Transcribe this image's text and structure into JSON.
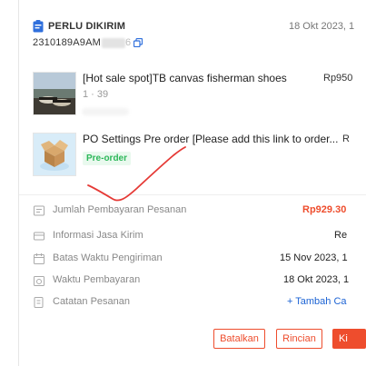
{
  "header": {
    "status": "PERLU DIKIRIM",
    "date": "18 Okt 2023, 1",
    "order_id": "2310189A9AM",
    "order_id_tail": "6"
  },
  "products": [
    {
      "name": "[Hot sale spot]TB canvas fisherman shoes",
      "meta": "1 · 39",
      "price": "Rp950"
    },
    {
      "name": "PO Settings Pre order [Please add this link to order...",
      "badge": "Pre-order",
      "price": "R"
    }
  ],
  "details": [
    {
      "icon": "receipt-icon",
      "label": "Jumlah Pembayaran Pesanan",
      "value": "Rp929.30"
    },
    {
      "icon": "shipping-info-icon",
      "label": "Informasi Jasa Kirim",
      "value": "Re"
    },
    {
      "icon": "calendar-icon",
      "label": "Batas Waktu Pengiriman",
      "value": "15 Nov 2023, 1"
    },
    {
      "icon": "payment-time-icon",
      "label": "Waktu Pembayaran",
      "value": "18 Okt 2023, 1"
    },
    {
      "icon": "notes-icon",
      "label": "Catatan Pesanan",
      "value": "+ Tambah Ca"
    }
  ],
  "actions": {
    "cancel": "Batalkan",
    "details": "Rincian",
    "primary": "Ki"
  },
  "colors": {
    "accent": "#ee4d2d",
    "link": "#1c63d4",
    "preorder": "#2db85a",
    "annotation": "#e53935"
  }
}
